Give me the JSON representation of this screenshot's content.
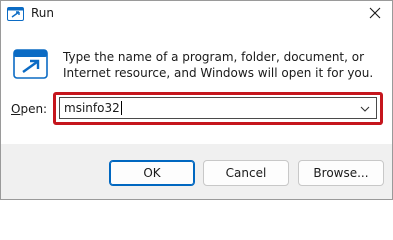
{
  "window": {
    "title": "Run",
    "title_icon": "run-app-icon",
    "close_icon": "close-icon"
  },
  "content": {
    "description": "Type the name of a program, folder, document, or Internet resource, and Windows will open it for you.",
    "open_label_mnemonic": "O",
    "open_label_rest": "pen:",
    "input_value": "msinfo32",
    "highlight_color": "#c5161d"
  },
  "buttons": {
    "ok": "OK",
    "cancel": "Cancel",
    "browse": "Browse..."
  }
}
